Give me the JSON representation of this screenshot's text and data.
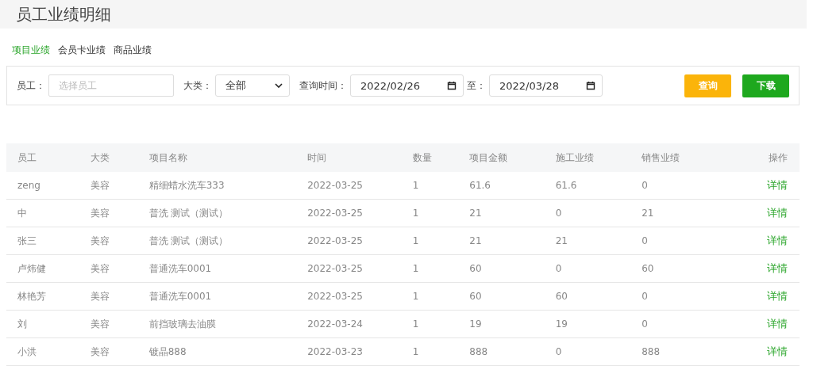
{
  "title": "员工业绩明细",
  "tabs": [
    {
      "label": "项目业绩",
      "selected": true
    },
    {
      "label": "会员卡业绩",
      "selected": false
    },
    {
      "label": "商品业绩",
      "selected": false
    }
  ],
  "filters": {
    "employee_label": "员工：",
    "employee_placeholder": "选择员工",
    "category_label": "大类：",
    "category_value": "全部",
    "time_label": "查询时间：",
    "date_from": "2022/02/26",
    "to_label": "至：",
    "date_to": "2022/03/28"
  },
  "buttons": [
    {
      "label": "查询",
      "kind": "query"
    },
    {
      "label": "下载",
      "kind": "download"
    }
  ],
  "table": {
    "columns": [
      "员工",
      "大类",
      "项目名称",
      "时间",
      "数量",
      "项目金额",
      "施工业绩",
      "销售业绩",
      "操作"
    ],
    "rows": [
      [
        "zeng",
        "美容",
        "精细蜡水洗车333",
        "2022-03-25",
        "1",
        "61.6",
        "61.6",
        "0",
        "详情"
      ],
      [
        "中",
        "美容",
        "普洗 测试（测试）",
        "2022-03-25",
        "1",
        "21",
        "0",
        "21",
        "详情"
      ],
      [
        "张三",
        "美容",
        "普洗 测试（测试）",
        "2022-03-25",
        "1",
        "21",
        "21",
        "0",
        "详情"
      ],
      [
        "卢炜健",
        "美容",
        "普通洗车0001",
        "2022-03-25",
        "1",
        "60",
        "0",
        "60",
        "详情"
      ],
      [
        "林艳芳",
        "美容",
        "普通洗车0001",
        "2022-03-25",
        "1",
        "60",
        "60",
        "0",
        "详情"
      ],
      [
        "刘",
        "美容",
        "前挡玻璃去油膜",
        "2022-03-24",
        "1",
        "19",
        "19",
        "0",
        "详情"
      ],
      [
        "小洪",
        "美容",
        "镀晶888",
        "2022-03-23",
        "1",
        "888",
        "0",
        "888",
        "详情"
      ]
    ]
  }
}
